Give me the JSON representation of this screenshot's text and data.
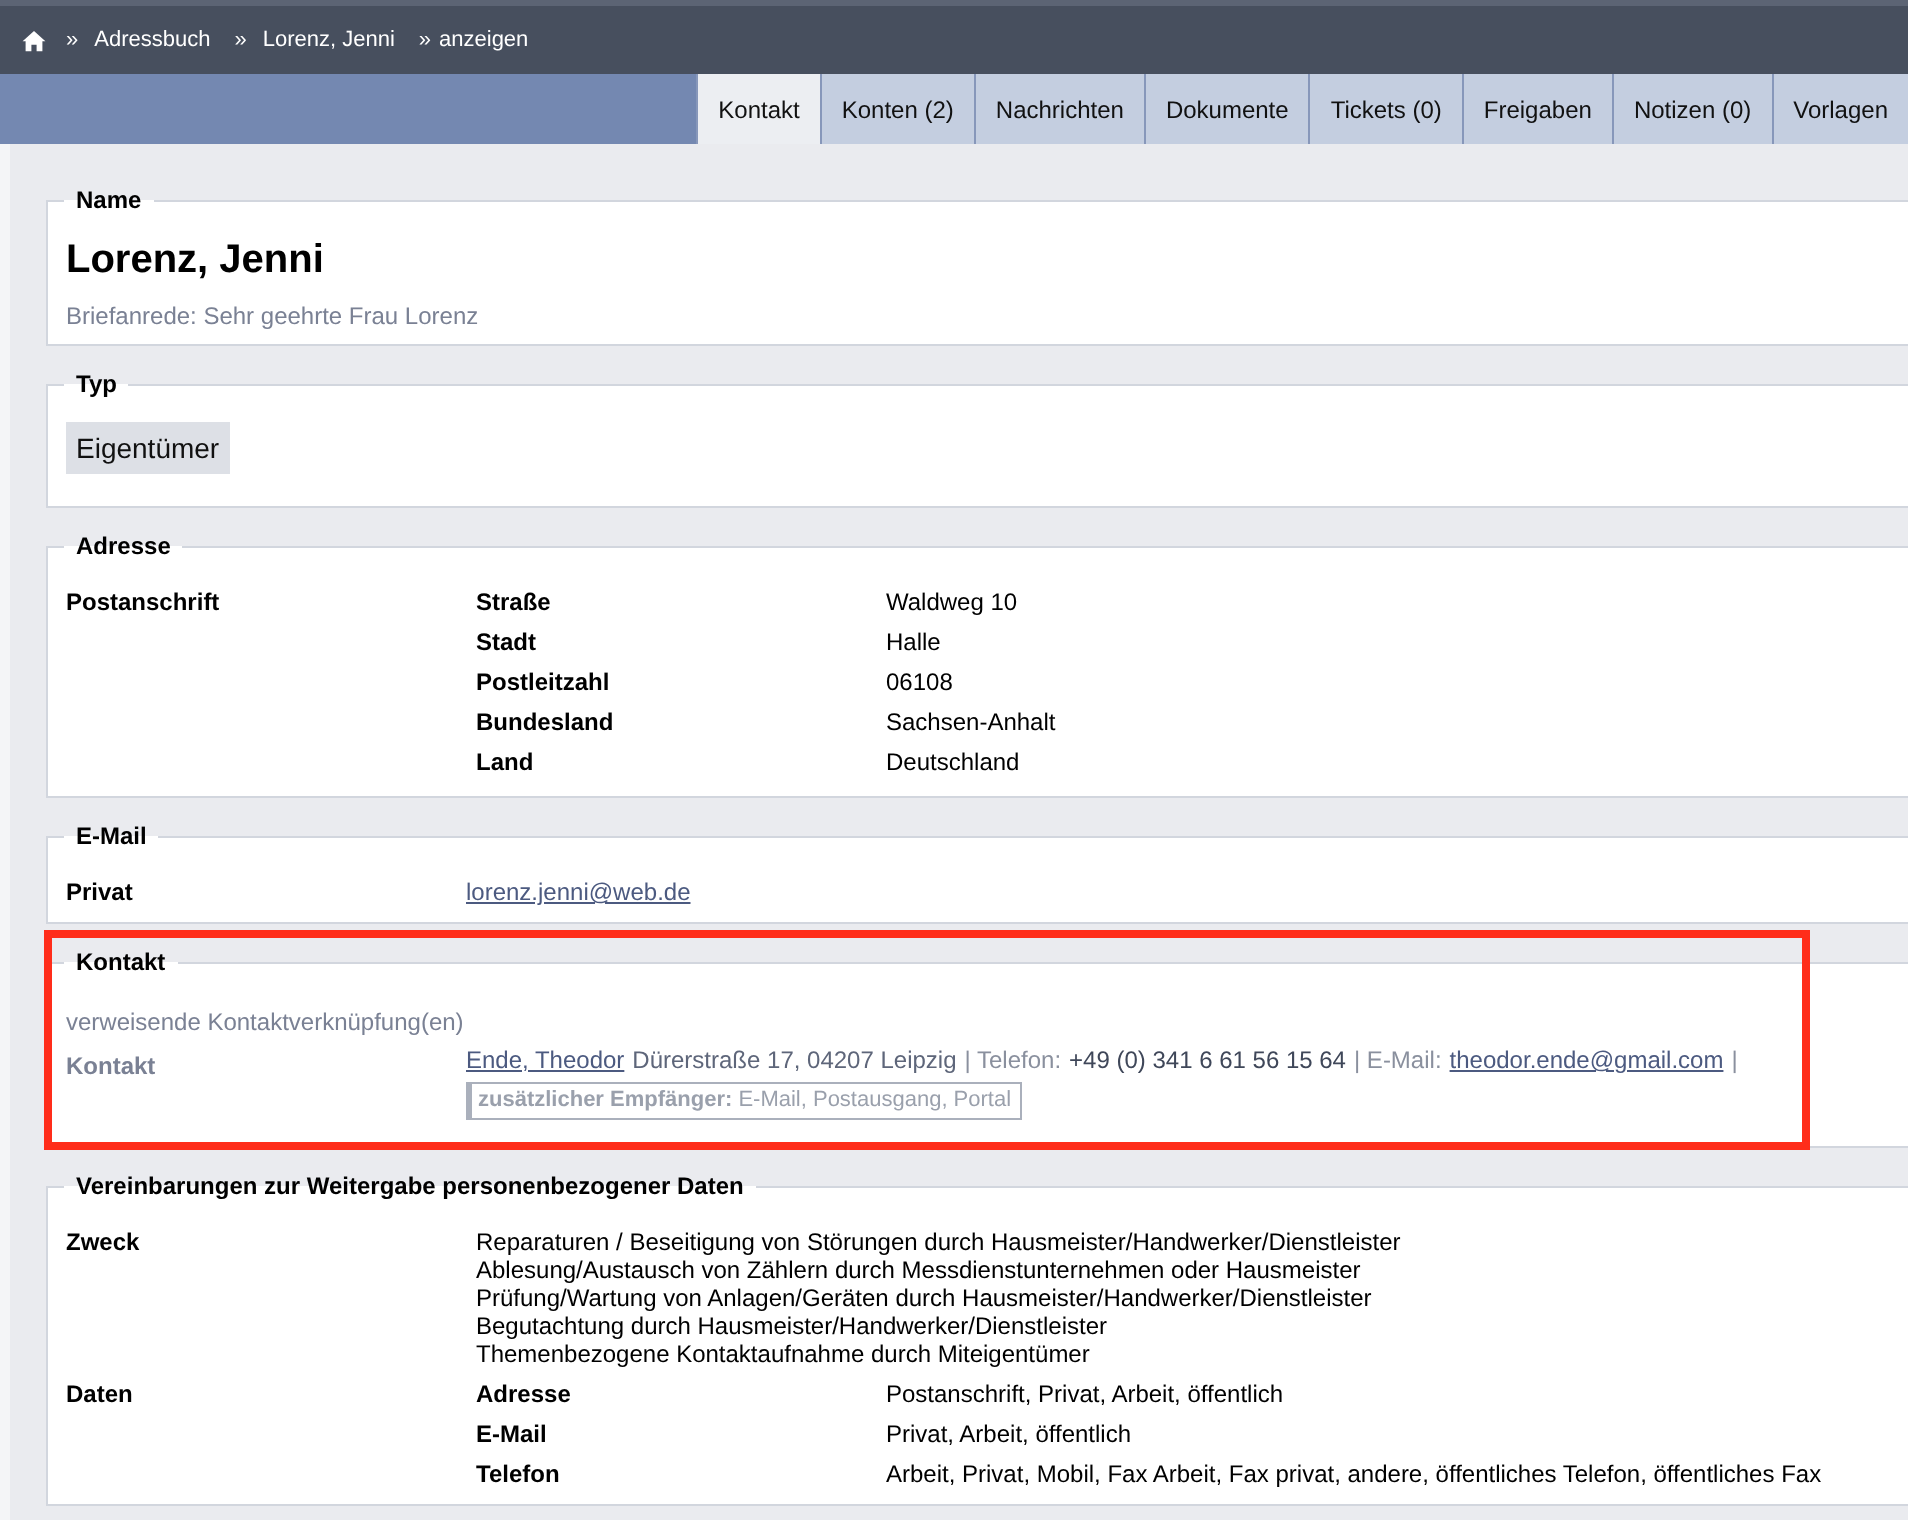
{
  "breadcrumb": [
    {
      "separator": "»",
      "label": "Adressbuch"
    },
    {
      "separator": "»",
      "label": "Lorenz, Jenni"
    },
    {
      "separator": "»",
      "label": "anzeigen"
    }
  ],
  "tabs": [
    {
      "label": "Kontakt",
      "selected": true
    },
    {
      "label": "Konten (2)",
      "selected": false
    },
    {
      "label": "Nachrichten",
      "selected": false
    },
    {
      "label": "Dokumente",
      "selected": false
    },
    {
      "label": "Tickets (0)",
      "selected": false
    },
    {
      "label": "Freigaben",
      "selected": false
    },
    {
      "label": "Notizen (0)",
      "selected": false
    },
    {
      "label": "Vorlagen",
      "selected": false
    }
  ],
  "sections": [
    {
      "kind": "name",
      "title": "Name",
      "highlighted": false,
      "name": "Lorenz, Jenni",
      "salutation": "Briefanrede: Sehr geehrte Frau Lorenz"
    },
    {
      "kind": "type",
      "title": "Typ",
      "highlighted": false,
      "tags": [
        "Eigentümer"
      ]
    },
    {
      "kind": "address",
      "title": "Adresse",
      "highlighted": false,
      "rows": [
        {
          "label": "Postanschrift",
          "fields": [
            {
              "label": "Straße",
              "value": "Waldweg 10"
            },
            {
              "label": "Stadt",
              "value": "Halle"
            },
            {
              "label": "Postleitzahl",
              "value": "06108"
            },
            {
              "label": "Bundesland",
              "value": "Sachsen-Anhalt"
            },
            {
              "label": "Land",
              "value": "Deutschland"
            }
          ]
        }
      ]
    },
    {
      "kind": "email",
      "title": "E-Mail",
      "highlighted": false,
      "rows": [
        {
          "label": "Privat",
          "email": "lorenz.jenni@web.de"
        }
      ]
    },
    {
      "kind": "contact",
      "title": "Kontakt",
      "highlighted": true,
      "note": "verweisende Kontaktverknüpfung(en)",
      "rows": [
        {
          "label": "Kontakt",
          "name": "Ende, Theodor",
          "address": "Dürerstraße 17, 04207 Leipzig",
          "phone_label": "| Telefon:",
          "phone": "+49 (0) 341 6 61 56 15 64",
          "email_label": "| E-Mail:",
          "email": "theodor.ende@gmail.com",
          "trailing": "|",
          "recipients": "**zusätzlicher Empfänger:** E-Mail, Postausgang, Portal"
        }
      ]
    },
    {
      "kind": "consent",
      "title": "Vereinbarungen zur Weitergabe personenbezogener Daten",
      "highlighted": false,
      "purpose_label": "Zweck",
      "purposes": [
        "Reparaturen / Beseitigung von Störungen durch Hausmeister/Handwerker/Dienstleister",
        "Ablesung/Austausch von Zählern durch Messdienstunternehmen oder Hausmeister",
        "Prüfung/Wartung von Anlagen/Geräten durch Hausmeister/Handwerker/Dienstleister",
        "Begutachtung durch Hausmeister/Handwerker/Dienstleister",
        "Themenbezogene Kontaktaufnahme durch Miteigentümer"
      ],
      "data_label": "Daten",
      "data": [
        {
          "label": "Adresse",
          "value": "Postanschrift, Privat, Arbeit, öffentlich"
        },
        {
          "label": "E-Mail",
          "value": "Privat, Arbeit, öffentlich"
        },
        {
          "label": "Telefon",
          "value": "Arbeit, Privat, Mobil, Fax Arbeit, Fax privat, andere, öffentliches Telefon, öffentliches Fax"
        }
      ]
    }
  ]
}
